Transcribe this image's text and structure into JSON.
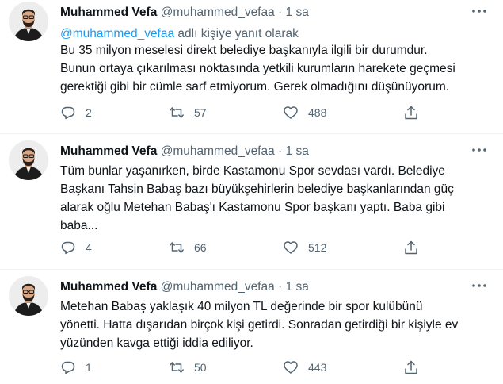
{
  "tweets": [
    {
      "name": "Muhammed Vefa",
      "handle": "@muhammed_vefaa",
      "dot": "·",
      "time": "1 sa",
      "reply_mention": "@muhammed_vefaa",
      "reply_suffix": " adlı kişiye yanıt olarak",
      "text": "Bu 35 milyon meselesi direkt belediye başkanıyla ilgili bir durumdur.\nBunun ortaya çıkarılması noktasında yetkili kurumların harekete geçmesi\ngerektiği gibi bir cümle sarf etmiyorum. Gerek olmadığını düşünüyorum.",
      "replies": "2",
      "retweets": "57",
      "likes": "488"
    },
    {
      "name": "Muhammed Vefa",
      "handle": "@muhammed_vefaa",
      "dot": "·",
      "time": "1 sa",
      "text": "Tüm bunlar yaşanırken, birde Kastamonu Spor sevdası vardı. Belediye\nBaşkanı Tahsin Babaş bazı büyükşehirlerin belediye başkanlarından güç\nalarak oğlu Metehan Babaş'ı Kastamonu Spor başkanı yaptı. Baba gibi\nbaba...",
      "replies": "4",
      "retweets": "66",
      "likes": "512"
    },
    {
      "name": "Muhammed Vefa",
      "handle": "@muhammed_vefaa",
      "dot": "·",
      "time": "1 sa",
      "text": "Metehan Babaş yaklaşık 40 milyon TL değerinde bir spor kulübünü\nyönetti. Hatta dışarıdan birçok kişi getirdi. Sonradan getirdiği bir kişiyle ev\nyüzünden kavga ettiği iddia ediliyor.",
      "replies": "1",
      "retweets": "50",
      "likes": "443"
    }
  ],
  "icons": {
    "more": "more-horizontal-icon",
    "reply": "reply-bubble-icon",
    "retweet": "retweet-icon",
    "like": "heart-icon",
    "share": "share-icon"
  },
  "colors": {
    "text": "#0f1419",
    "secondary": "#536471",
    "link": "#1d9bf0",
    "divider": "#eff3f4"
  }
}
